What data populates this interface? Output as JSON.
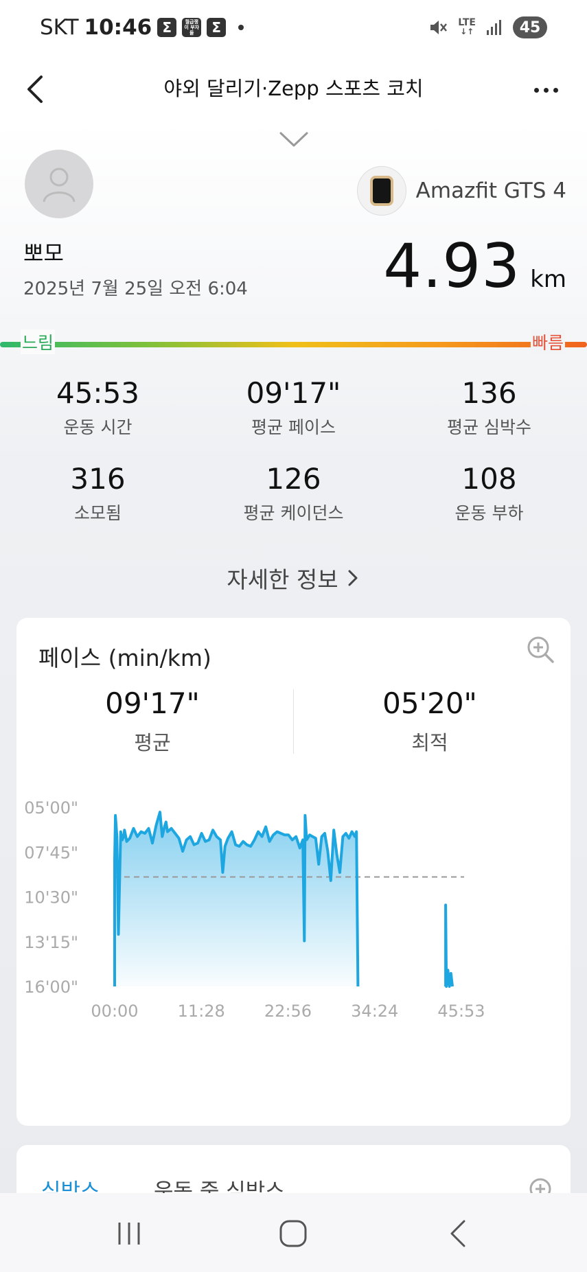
{
  "status_bar": {
    "carrier": "SKT",
    "time": "10:46",
    "app_icons": [
      "Σ",
      "월급쟁이 부자들",
      "Σ"
    ],
    "network": "LTE",
    "battery": "45"
  },
  "header": {
    "title": "야외 달리기·Zepp 스포츠 코치"
  },
  "workout": {
    "device_name": "Amazfit GTS 4",
    "user_name": "뽀모",
    "date": "2025년 7월 25일 오전 6:04",
    "distance": "4.93",
    "distance_unit": "km",
    "speed_slow": "느림",
    "speed_fast": "빠름"
  },
  "stats": [
    {
      "value": "45:53",
      "label": "운동 시간"
    },
    {
      "value": "09'17\"",
      "label": "평균 페이스"
    },
    {
      "value": "136",
      "label": "평균 심박수"
    },
    {
      "value": "316",
      "label": "소모됨"
    },
    {
      "value": "126",
      "label": "평균 케이던스"
    },
    {
      "value": "108",
      "label": "운동 부하"
    }
  ],
  "detail_link": "자세한 정보",
  "pace_card": {
    "title": "페이스 (min/km)",
    "average_value": "09'17\"",
    "average_label": "평균",
    "best_value": "05'20\"",
    "best_label": "최적"
  },
  "second_card": {
    "tab_active": "심박스",
    "tab_other": "운동 중 심박스"
  },
  "colors": {
    "accent": "#1a8fd6",
    "line": "#1da6e0",
    "fill_top": "#7fcdef",
    "slow": "#2aaa5a",
    "fast": "#e4533a"
  },
  "chart_data": {
    "type": "area",
    "title": "페이스 (min/km)",
    "xlabel": "",
    "ylabel": "",
    "x_ticks": [
      "00:00",
      "11:28",
      "22:56",
      "34:24",
      "45:53"
    ],
    "y_ticks": [
      "05'00\"",
      "07'45\"",
      "10'30\"",
      "13'15\"",
      "16'00\""
    ],
    "xlim_minutes": [
      0,
      45.88
    ],
    "ylim_pace_minutes": [
      5,
      16
    ],
    "y_inverted": true,
    "average_line_pace_minutes": 9.28,
    "grid": false,
    "legend": "none",
    "series": [
      {
        "x_minutes": [
          0,
          0.1,
          0.3,
          0.5,
          0.8,
          1.0,
          1.2,
          1.3,
          1.6,
          2.0,
          2.5,
          3.0,
          3.5,
          4.0,
          4.5,
          5.0,
          5.5,
          6.0,
          6.3,
          6.6,
          6.8,
          7.0,
          7.5,
          8.0,
          8.5,
          9.0,
          9.5,
          10.0,
          10.5,
          11.0,
          11.5,
          12.0,
          12.5,
          13.0,
          13.5,
          14.0,
          14.3,
          14.6,
          15.0,
          15.5,
          16.0,
          16.5,
          17.0,
          17.5,
          18.0,
          18.5,
          19.0,
          19.5,
          20.0,
          20.5,
          21.0,
          21.5,
          22.0,
          22.5,
          23.0,
          23.5,
          24.0,
          24.5,
          24.9,
          25.1,
          25.2,
          25.4,
          25.8,
          26.2,
          26.6,
          27.0,
          27.4,
          27.8,
          28.2,
          28.6,
          29.0,
          29.4,
          29.8,
          30.2,
          30.6,
          31.0,
          31.4,
          31.8,
          32.0,
          32.2,
          43.8,
          43.9,
          44.1,
          44.3,
          44.5,
          44.7
        ],
        "y_pace_minutes": [
          8.2,
          5.5,
          6.8,
          12.8,
          6.5,
          7.0,
          6.8,
          6.4,
          7.1,
          6.9,
          6.3,
          6.8,
          6.5,
          6.6,
          6.3,
          7.2,
          6.1,
          5.3,
          6.8,
          6.2,
          5.9,
          6.5,
          6.3,
          6.6,
          6.9,
          7.7,
          7.0,
          6.8,
          7.3,
          7.2,
          6.6,
          7.1,
          7.0,
          6.4,
          6.8,
          7.0,
          9.0,
          7.4,
          6.9,
          6.5,
          7.3,
          7.4,
          7.1,
          7.3,
          7.4,
          7.0,
          6.5,
          6.8,
          6.2,
          7.1,
          6.7,
          6.5,
          6.6,
          6.7,
          6.7,
          7.0,
          6.8,
          7.5,
          7.0,
          13.2,
          5.5,
          7.0,
          6.7,
          6.8,
          6.9,
          8.5,
          6.8,
          6.6,
          7.7,
          9.5,
          6.4,
          7.9,
          9.0,
          6.8,
          6.6,
          6.9,
          6.5,
          6.8,
          6.5,
          16.0,
          11.0,
          16.0,
          15.0,
          16.0,
          15.2,
          16.0
        ]
      }
    ]
  }
}
